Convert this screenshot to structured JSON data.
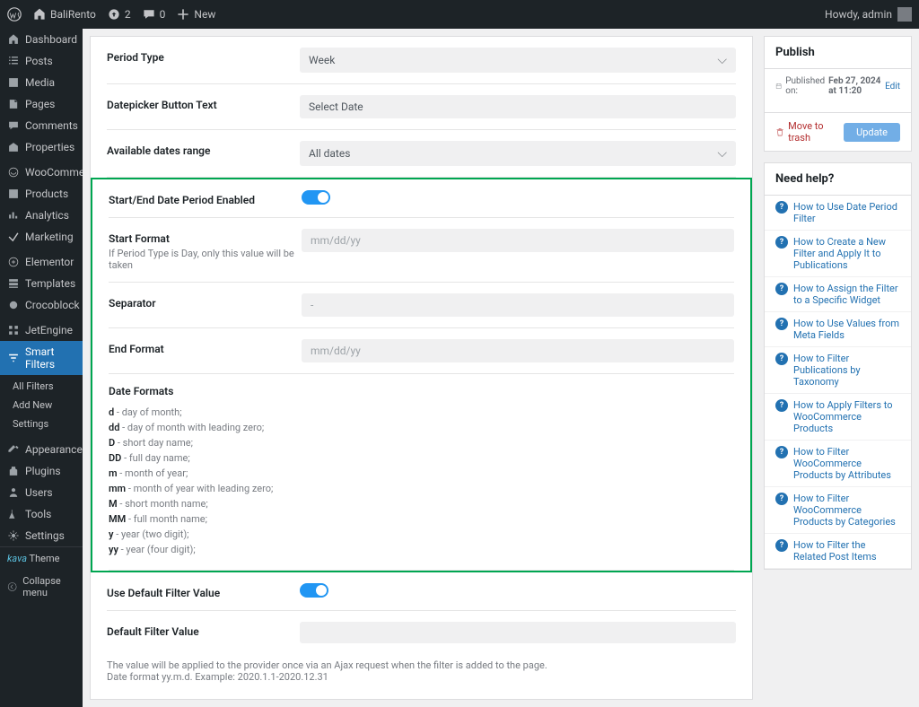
{
  "topbar": {
    "site_name": "BaliRento",
    "updates_count": "2",
    "comments_count": "0",
    "new_label": "New",
    "howdy": "Howdy, admin"
  },
  "sidebar": {
    "items": [
      {
        "label": "Dashboard"
      },
      {
        "label": "Posts"
      },
      {
        "label": "Media"
      },
      {
        "label": "Pages"
      },
      {
        "label": "Comments"
      },
      {
        "label": "Properties"
      },
      {
        "label": "WooCommerce"
      },
      {
        "label": "Products"
      },
      {
        "label": "Analytics"
      },
      {
        "label": "Marketing"
      },
      {
        "label": "Elementor"
      },
      {
        "label": "Templates"
      },
      {
        "label": "Crocoblock"
      },
      {
        "label": "JetEngine"
      },
      {
        "label": "Smart Filters"
      },
      {
        "label": "Appearance"
      },
      {
        "label": "Plugins"
      },
      {
        "label": "Users"
      },
      {
        "label": "Tools"
      },
      {
        "label": "Settings"
      }
    ],
    "smart_filters_sub": [
      "All Filters",
      "Add New",
      "Settings"
    ],
    "kava_prefix": "kava",
    "kava_label": "Theme",
    "collapse": "Collapse menu"
  },
  "fields": {
    "period_type": {
      "label": "Period Type",
      "value": "Week"
    },
    "datepicker_btn": {
      "label": "Datepicker Button Text",
      "value": "Select Date"
    },
    "avail_dates": {
      "label": "Available dates range",
      "value": "All dates"
    },
    "start_end_enabled": {
      "label": "Start/End Date Period Enabled"
    },
    "start_format": {
      "label": "Start Format",
      "placeholder": "mm/dd/yy",
      "desc": "If Period Type is Day, only this value will be taken"
    },
    "separator": {
      "label": "Separator",
      "placeholder": "-"
    },
    "end_format": {
      "label": "End Format",
      "placeholder": "mm/dd/yy"
    },
    "date_formats_title": "Date Formats",
    "date_formats": [
      {
        "k": "d",
        "v": "day of month;"
      },
      {
        "k": "dd",
        "v": "day of month with leading zero;"
      },
      {
        "k": "D",
        "v": "short day name;"
      },
      {
        "k": "DD",
        "v": "full day name;"
      },
      {
        "k": "m",
        "v": "month of year;"
      },
      {
        "k": "mm",
        "v": "month of year with leading zero;"
      },
      {
        "k": "M",
        "v": "short month name;"
      },
      {
        "k": "MM",
        "v": "full month name;"
      },
      {
        "k": "y",
        "v": "year (two digit);"
      },
      {
        "k": "yy",
        "v": "year (four digit);"
      }
    ],
    "use_default": {
      "label": "Use Default Filter Value"
    },
    "default_value": {
      "label": "Default Filter Value",
      "desc1": "The value will be applied to the provider once via an Ajax request when the filter is added to the page.",
      "desc2": "Date format yy.m.d. Example: 2020.1.1-2020.12.31"
    }
  },
  "publish": {
    "title": "Publish",
    "on": "Published on:",
    "date": "Feb 27, 2024 at 11:20",
    "edit": "Edit",
    "trash": "Move to trash",
    "update": "Update"
  },
  "help": {
    "title": "Need help?",
    "links": [
      "How to Use Date Period Filter",
      "How to Create a New Filter and Apply It to Publications",
      "How to Assign the Filter to a Specific Widget",
      "How to Use Values from Meta Fields",
      "How to Filter Publications by Taxonomy",
      "How to Apply Filters to WooCommerce Products",
      "How to Filter WooCommerce Products by Attributes",
      "How to Filter WooCommerce Products by Categories",
      "How to Filter the Related Post Items"
    ]
  }
}
